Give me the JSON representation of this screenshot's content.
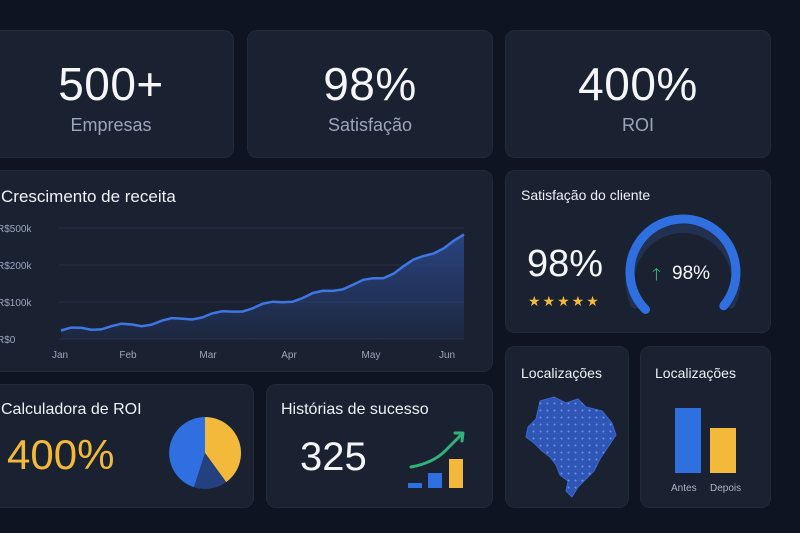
{
  "stats": [
    {
      "value": "500+",
      "label": "Empresas"
    },
    {
      "value": "98%",
      "label": "Satisfação"
    },
    {
      "value": "400%",
      "label": "ROI"
    }
  ],
  "revenue": {
    "title": "Crescimento de receita"
  },
  "chart_data": {
    "type": "area",
    "categories": [
      "Jan",
      "Feb",
      "Mar",
      "Apr",
      "May",
      "Jun"
    ],
    "y_tick_labels": [
      "R$0",
      "R$100k",
      "R$200k",
      "R$500k"
    ],
    "series": [
      {
        "values": [
          0.07,
          0.12,
          0.21,
          0.34,
          0.51,
          0.84
        ]
      }
    ],
    "grid": true,
    "colors": {
      "line": "#3e76e6",
      "fill": "#2c4a8f"
    }
  },
  "satisfaction": {
    "title": "Satisfação do cliente",
    "value": "98%",
    "stars": "★★★★★",
    "gauge_arrow": "🡑",
    "gauge_value": "98%",
    "gauge_level": 0.98
  },
  "roi": {
    "title": "Calculadora de ROI",
    "value": "400%",
    "pie": [
      {
        "fraction": 0.4,
        "color": "#f2b93b"
      },
      {
        "fraction": 0.15,
        "color": "#24407e"
      },
      {
        "fraction": 0.45,
        "color": "#2f6fe0"
      }
    ]
  },
  "stories": {
    "title": "Histórias de sucesso",
    "value": "325"
  },
  "map": {
    "title": "Localizações",
    "icon": "brazil-map-icon"
  },
  "bars": {
    "title": "Localizações",
    "items": [
      {
        "label": "Antes",
        "value": 0.86,
        "color": "#2f6fe0"
      },
      {
        "label": "Depois",
        "value": 0.6,
        "color": "#f2b93b"
      }
    ]
  },
  "colors": {
    "background": "#0f1422",
    "card": "#1a2130",
    "accent_blue": "#2f6fe0",
    "accent_yellow": "#f2b93b",
    "accent_green": "#2fb37a"
  }
}
